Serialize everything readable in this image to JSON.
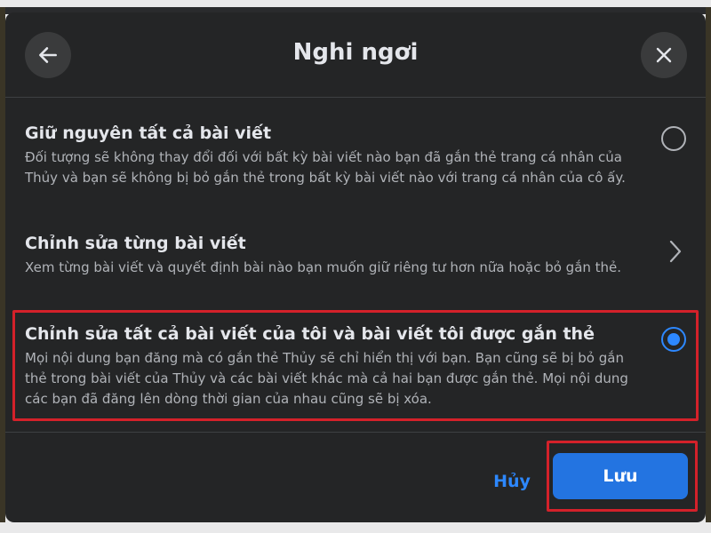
{
  "dialog": {
    "title": "Nghi ngơi"
  },
  "options": [
    {
      "title": "Giữ nguyên tất cả bài viết",
      "description": "Đối tượng sẽ không thay đổi đối với bất kỳ bài viết nào bạn đã gắn thẻ trang cá nhân của Thủy và bạn sẽ không bị bỏ gắn thẻ trong bất kỳ bài viết nào với trang cá nhân của cô ấy.",
      "control": "radio",
      "selected": false
    },
    {
      "title": "Chỉnh sửa từng bài viết",
      "description": "Xem từng bài viết và quyết định bài nào bạn muốn giữ riêng tư hơn nữa hoặc bỏ gắn thẻ.",
      "control": "chevron-right-icon",
      "selected": false
    },
    {
      "title": "Chỉnh sửa tất cả bài viết của tôi và bài viết tôi được gắn thẻ",
      "description": "Mọi nội dung bạn đăng mà có gắn thẻ Thủy sẽ chỉ hiển thị với bạn. Bạn cũng sẽ bị bỏ gắn thẻ trong bài viết của Thủy và các bài viết khác mà cả hai bạn được gắn thẻ. Mọi nội dung các bạn đã đăng lên dòng thời gian của nhau cũng sẽ bị xóa.",
      "control": "radio",
      "selected": true
    }
  ],
  "footer": {
    "cancel_label": "Hủy",
    "save_label": "Lưu"
  },
  "icons": {
    "back": "arrow-left-icon",
    "close": "close-icon"
  },
  "colors": {
    "modal_bg": "#242526",
    "accent": "#2d88ff",
    "save_bg": "#2374e1",
    "highlight": "#d4212a"
  }
}
